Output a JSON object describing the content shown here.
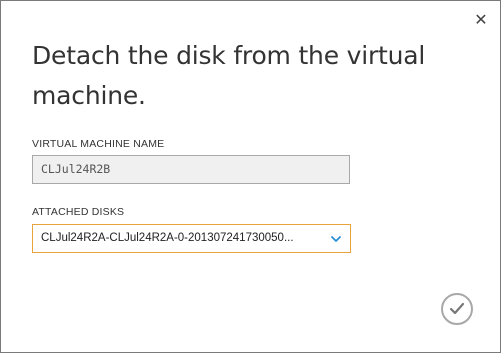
{
  "dialog": {
    "title": "Detach the disk from the virtual machine.",
    "close_glyph": "✕",
    "close_icon": "close-icon",
    "confirm_icon": "checkmark-icon"
  },
  "fields": {
    "vm_name": {
      "label": "VIRTUAL MACHINE NAME",
      "value": "CLJul24R2B"
    },
    "attached_disks": {
      "label": "ATTACHED DISKS",
      "selected": "CLJul24R2A-CLJul24R2A-0-201307241730050...",
      "dropdown_icon": "chevron-down-icon"
    }
  },
  "colors": {
    "focus_border": "#e8a33c",
    "chevron": "#2a8fd6",
    "confirm_ring": "#a8a8a8"
  }
}
